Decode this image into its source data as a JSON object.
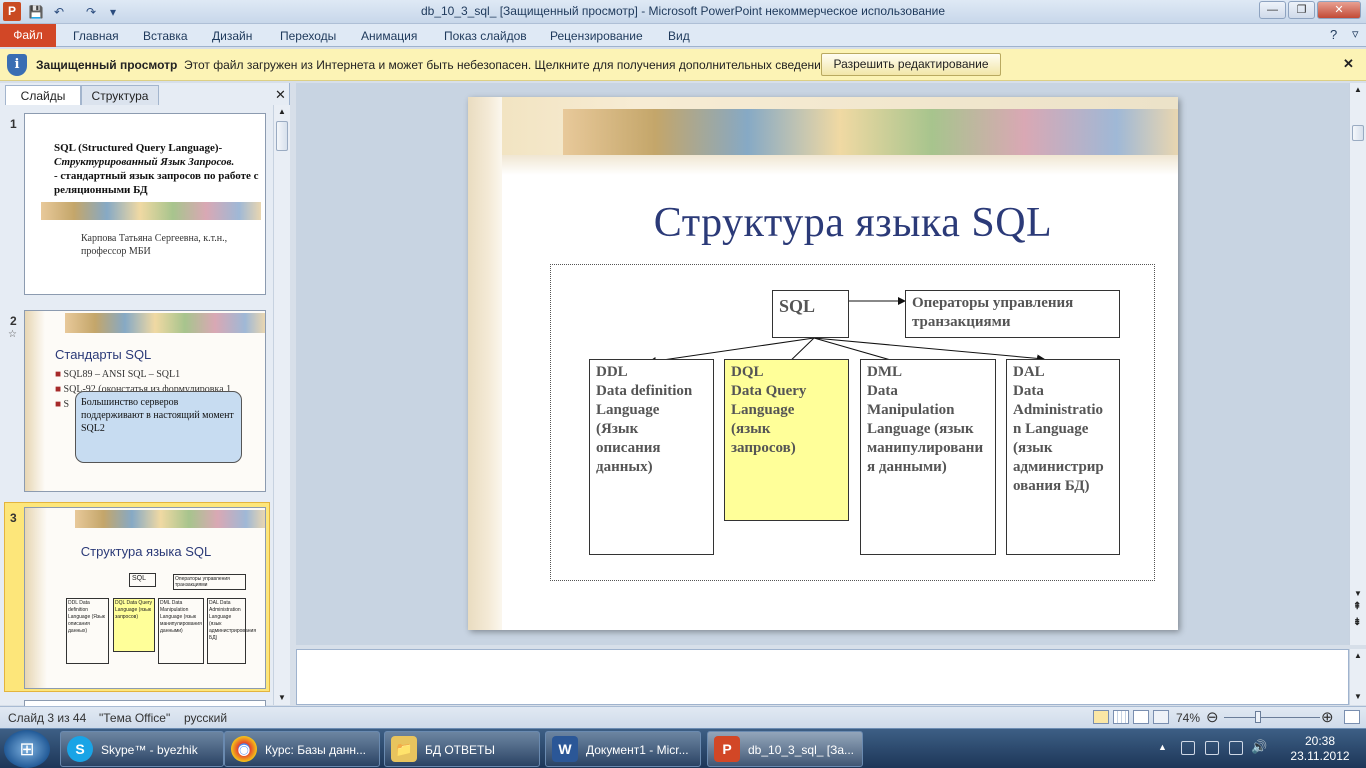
{
  "window": {
    "title": "db_10_3_sql_ [Защищенный просмотр] - Microsoft PowerPoint некоммерческое использование",
    "app_icon": "P",
    "minimize": "—",
    "maximize": "❐",
    "close": "✕"
  },
  "quick_access": {
    "save": "💾",
    "undo": "↶",
    "redo": "↷",
    "customize": "▾"
  },
  "ribbon": {
    "file_tab": "Файл",
    "tabs": [
      "Главная",
      "Вставка",
      "Дизайн",
      "Переходы",
      "Анимация",
      "Показ слайдов",
      "Рецензирование",
      "Вид"
    ],
    "help": "?",
    "collapse": "▿"
  },
  "message_bar": {
    "icon": "i",
    "title": "Защищенный просмотр",
    "text": "Этот файл загружен из Интернета и может быть небезопасен. Щелкните для получения дополнительных сведений.",
    "button": "Разрешить редактирование",
    "close": "✕"
  },
  "left_panel": {
    "tab_slides": "Слайды",
    "tab_outline": "Структура",
    "close": "✕",
    "slides": [
      {
        "num": "1",
        "title_line1": "SQL (Structured Query Language)-",
        "title_line2": "Структурированный Язык Запросов.",
        "title_line3": "- стандартный язык запросов по работе с реляционными БД",
        "author": "Карпова Татьяна Сергеевна, к.т.н., профессор МБИ"
      },
      {
        "num": "2",
        "star": "☆",
        "heading": "Стандарты SQL",
        "bullets": [
          "SQL89 – ANSI SQL – SQL1",
          "SQL-92 (оконстатья из формулировка 1",
          "S"
        ],
        "callout": "Большинство серверов  поддерживают  в настоящий момент SQL2"
      },
      {
        "num": "3",
        "heading": "Структура языка SQL",
        "sql": "SQL",
        "ops": "Операторы управления транзакциями",
        "ddl": "DDL Data definition Language (Язык описания данных)",
        "dql": "DQL Data Query Language (язык запросов)",
        "dml": "DML Data Manipulation Language (язык манипулирования данными)",
        "dal": "DAL Data Administration Language (язык администрирования БД)"
      }
    ]
  },
  "slide": {
    "title": "Структура  языка SQL",
    "sql": "SQL",
    "ops": "Операторы управления транзакциями",
    "ddl": [
      "DDL",
      "Data definition",
      "Language",
      "(Язык",
      "описания",
      "данных)"
    ],
    "dql": [
      "DQL",
      "Data Query",
      "Language",
      "(язык",
      "запросов)"
    ],
    "dml": [
      "DML",
      "Data",
      "Manipulation",
      "Language (язык",
      "манипулировани",
      "я данными)"
    ],
    "dal": [
      "DAL",
      "Data",
      "Administratio",
      "n Language",
      "(язык",
      "администрир",
      "ования БД)"
    ]
  },
  "status": {
    "slide": "Слайд 3 из 44",
    "theme": "\"Тема Office\"",
    "lang": "русский",
    "zoom": "74%",
    "zoom_value": 0.74
  },
  "taskbar": {
    "start": "⊞",
    "items": [
      {
        "label": "Skype™ - byezhik",
        "icon": "S"
      },
      {
        "label": "Курс: Базы данн...",
        "icon": "◉"
      },
      {
        "label": "БД ОТВЕТЫ",
        "icon": "📁"
      },
      {
        "label": "Документ1 - Micr...",
        "icon": "W"
      },
      {
        "label": "db_10_3_sql_ [За...",
        "icon": "P"
      }
    ],
    "time": "20:38",
    "date": "23.11.2012"
  },
  "colors": {
    "accent": "#d24726",
    "title_blue": "#2b3a78",
    "dql_fill": "#ffff99",
    "selection": "#fde67a"
  }
}
